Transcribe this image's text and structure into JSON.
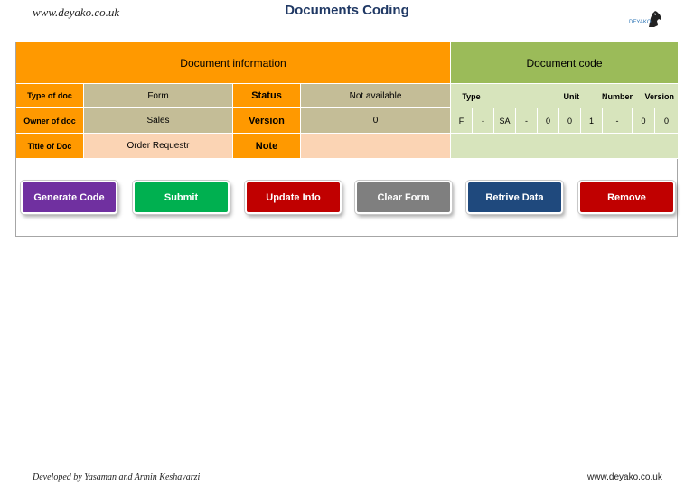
{
  "header": {
    "site_left": "www.deyako.co.uk",
    "title": "Documents Coding",
    "logo_text": "DEYAKO",
    "logo_icon": "horse-head-icon"
  },
  "info": {
    "section_title": "Document information",
    "type_label": "Type of doc",
    "type_value": "Form",
    "status_label": "Status",
    "status_value": "Not available",
    "owner_label": "Owner of doc",
    "owner_value": "Sales",
    "version_label": "Version",
    "version_value": "0",
    "title_label": "Title of Doc",
    "title_value": "Order Requestr",
    "note_label": "Note",
    "note_value": ""
  },
  "code": {
    "section_title": "Document code",
    "headers": {
      "type": "Type",
      "unit": "Unit",
      "number": "Number",
      "version": "Version"
    },
    "chars": [
      "F",
      "-",
      "SA",
      "-",
      "0",
      "0",
      "1",
      "-",
      "0",
      "0"
    ]
  },
  "buttons": [
    {
      "label": "Generate Code",
      "color": "#7030a0"
    },
    {
      "label": "Submit",
      "color": "#00b050"
    },
    {
      "label": "Update Info",
      "color": "#c00000"
    },
    {
      "label": "Clear Form",
      "color": "#7f7f7f"
    },
    {
      "label": "Retrive Data",
      "color": "#1f497d"
    },
    {
      "label": "Remove",
      "color": "#c00000"
    }
  ],
  "footer": {
    "credits": "Developed by Yasaman and Armin Keshavarzi",
    "site": "www.deyako.co.uk"
  },
  "colors": {
    "orange": "#ff9900",
    "green_header": "#9bbb59",
    "green_light": "#d7e4bc",
    "tan": "#c4bd97",
    "peach": "#fbd4b4"
  }
}
